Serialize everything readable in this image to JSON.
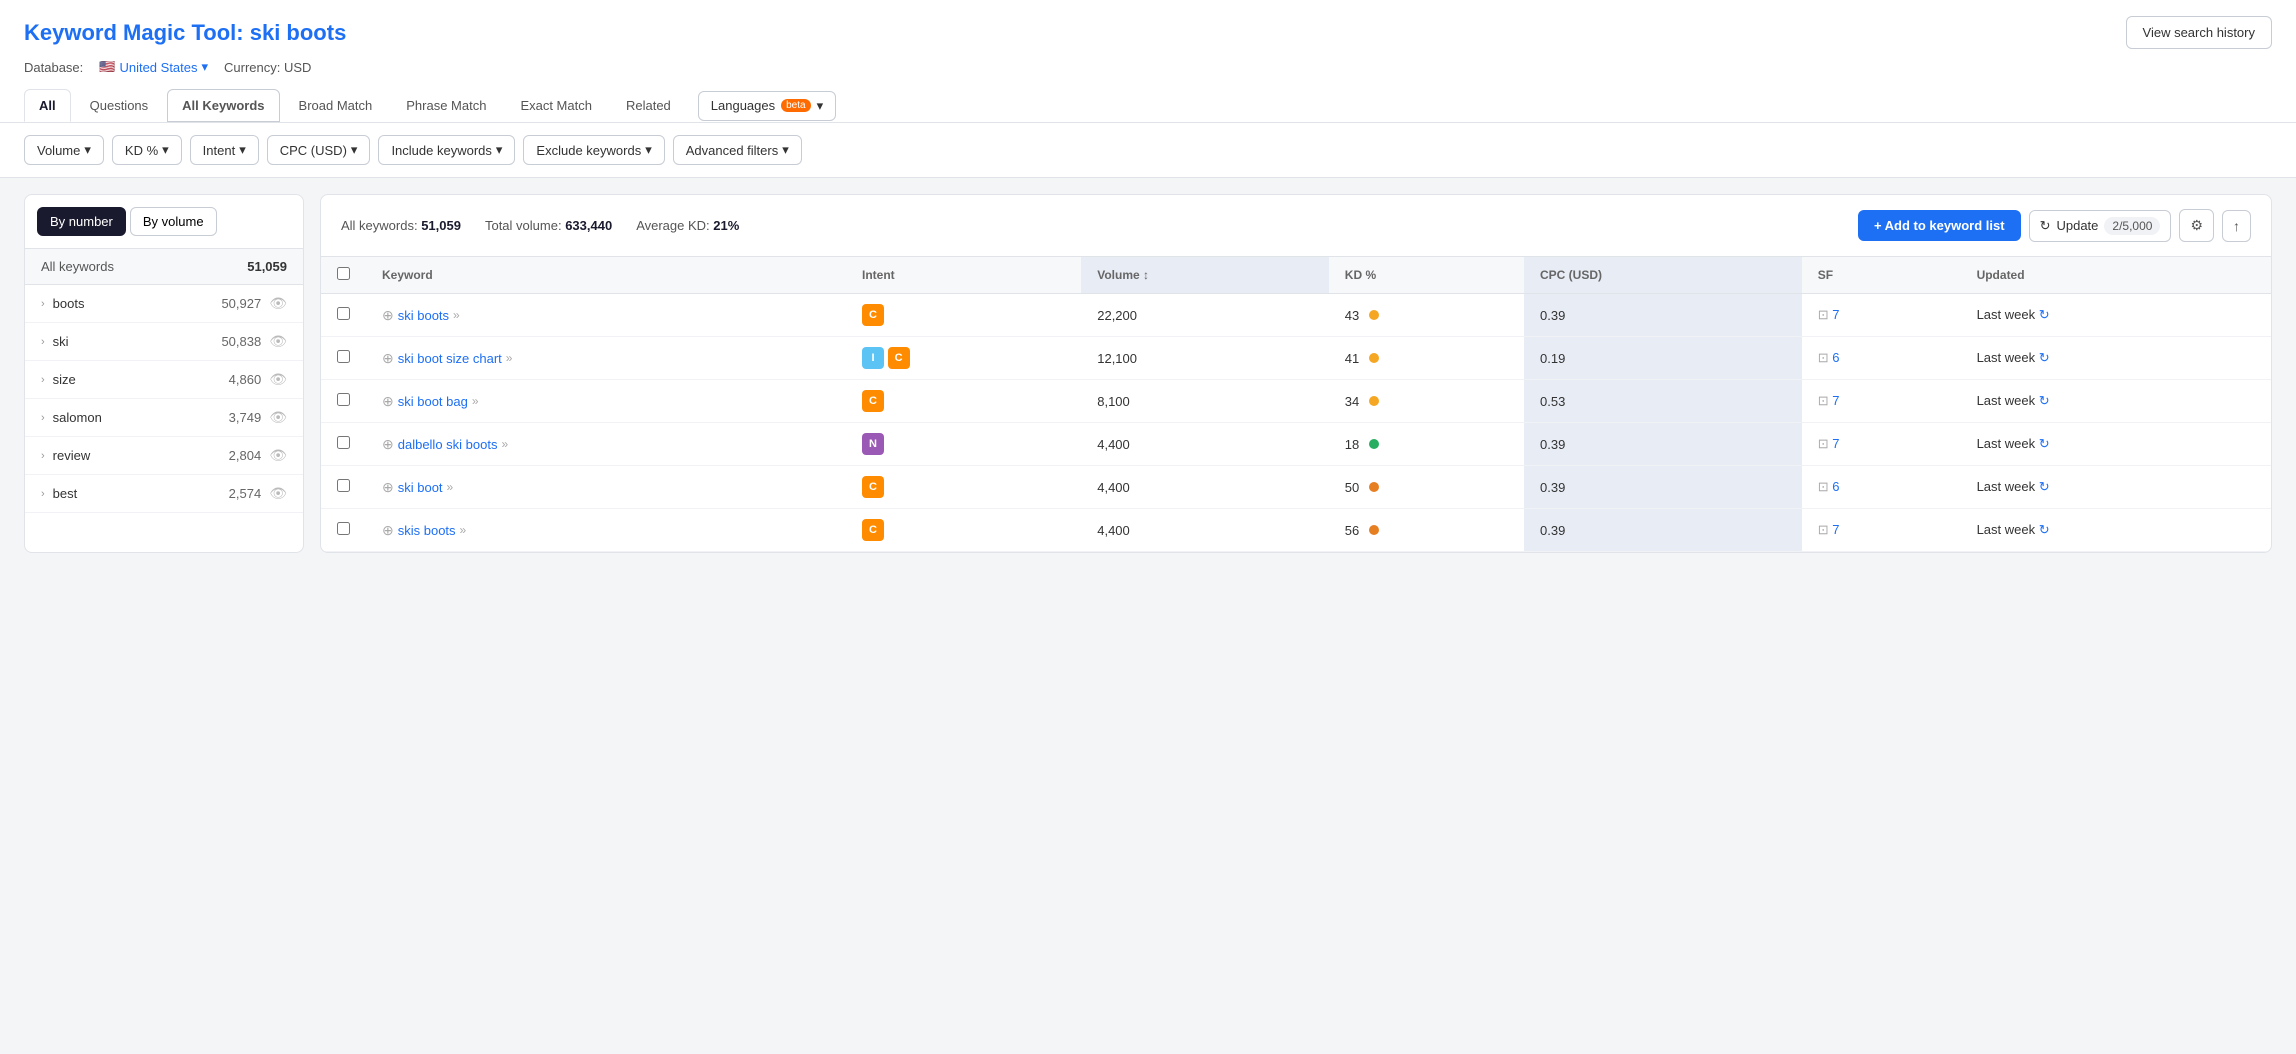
{
  "header": {
    "title_static": "Keyword Magic Tool:",
    "title_keyword": "ski boots",
    "view_history_label": "View search history"
  },
  "database": {
    "label": "Database:",
    "flag": "🇺🇸",
    "country": "United States",
    "currency_label": "Currency: USD"
  },
  "tabs": [
    {
      "id": "all",
      "label": "All",
      "active": true
    },
    {
      "id": "questions",
      "label": "Questions",
      "active": false
    },
    {
      "id": "all-keywords",
      "label": "All Keywords",
      "active": false
    },
    {
      "id": "broad-match",
      "label": "Broad Match",
      "active": false
    },
    {
      "id": "phrase-match",
      "label": "Phrase Match",
      "active": false
    },
    {
      "id": "exact-match",
      "label": "Exact Match",
      "active": false
    },
    {
      "id": "related",
      "label": "Related",
      "active": false
    }
  ],
  "languages_btn": "Languages",
  "beta_badge": "beta",
  "filters": [
    {
      "id": "volume",
      "label": "Volume"
    },
    {
      "id": "kd",
      "label": "KD %"
    },
    {
      "id": "intent",
      "label": "Intent"
    },
    {
      "id": "cpc",
      "label": "CPC (USD)"
    },
    {
      "id": "include",
      "label": "Include keywords"
    },
    {
      "id": "exclude",
      "label": "Exclude keywords"
    },
    {
      "id": "advanced",
      "label": "Advanced filters"
    }
  ],
  "sidebar": {
    "sort_by_number": "By number",
    "sort_by_volume": "By volume",
    "all_keywords_label": "All keywords",
    "all_keywords_count": "51,059",
    "items": [
      {
        "keyword": "boots",
        "count": "50,927"
      },
      {
        "keyword": "ski",
        "count": "50,838"
      },
      {
        "keyword": "size",
        "count": "4,860"
      },
      {
        "keyword": "salomon",
        "count": "3,749"
      },
      {
        "keyword": "review",
        "count": "2,804"
      },
      {
        "keyword": "best",
        "count": "2,574"
      }
    ]
  },
  "main": {
    "all_keywords_label": "All keywords:",
    "all_keywords_count": "51,059",
    "total_volume_label": "Total volume:",
    "total_volume": "633,440",
    "avg_kd_label": "Average KD:",
    "avg_kd": "21%",
    "add_to_list_label": "+ Add to keyword list",
    "update_label": "Update",
    "update_counter": "2/5,000",
    "columns": [
      {
        "id": "keyword",
        "label": "Keyword"
      },
      {
        "id": "intent",
        "label": "Intent"
      },
      {
        "id": "volume",
        "label": "Volume",
        "sorted": true
      },
      {
        "id": "kd",
        "label": "KD %"
      },
      {
        "id": "cpc",
        "label": "CPC (USD)",
        "highlighted": true
      },
      {
        "id": "sf",
        "label": "SF"
      },
      {
        "id": "updated",
        "label": "Updated"
      }
    ],
    "rows": [
      {
        "keyword": "ski boots",
        "intent": [
          "C"
        ],
        "intent_types": [
          "c"
        ],
        "volume": "22,200",
        "kd": "43",
        "kd_dot": "yellow",
        "cpc": "0.39",
        "sf": "7",
        "updated": "Last week"
      },
      {
        "keyword": "ski boot size chart",
        "intent": [
          "I",
          "C"
        ],
        "intent_types": [
          "i",
          "c"
        ],
        "volume": "12,100",
        "kd": "41",
        "kd_dot": "yellow",
        "cpc": "0.19",
        "sf": "6",
        "updated": "Last week"
      },
      {
        "keyword": "ski boot bag",
        "intent": [
          "C"
        ],
        "intent_types": [
          "c"
        ],
        "volume": "8,100",
        "kd": "34",
        "kd_dot": "yellow",
        "cpc": "0.53",
        "sf": "7",
        "updated": "Last week"
      },
      {
        "keyword": "dalbello ski boots",
        "intent": [
          "N"
        ],
        "intent_types": [
          "n"
        ],
        "volume": "4,400",
        "kd": "18",
        "kd_dot": "green",
        "cpc": "0.39",
        "sf": "7",
        "updated": "Last week"
      },
      {
        "keyword": "ski boot",
        "intent": [
          "C"
        ],
        "intent_types": [
          "c"
        ],
        "volume": "4,400",
        "kd": "50",
        "kd_dot": "orange",
        "cpc": "0.39",
        "sf": "6",
        "updated": "Last week"
      },
      {
        "keyword": "skis boots",
        "intent": [
          "C"
        ],
        "intent_types": [
          "c"
        ],
        "volume": "4,400",
        "kd": "56",
        "kd_dot": "orange",
        "cpc": "0.39",
        "sf": "7",
        "updated": "Last week"
      }
    ]
  }
}
